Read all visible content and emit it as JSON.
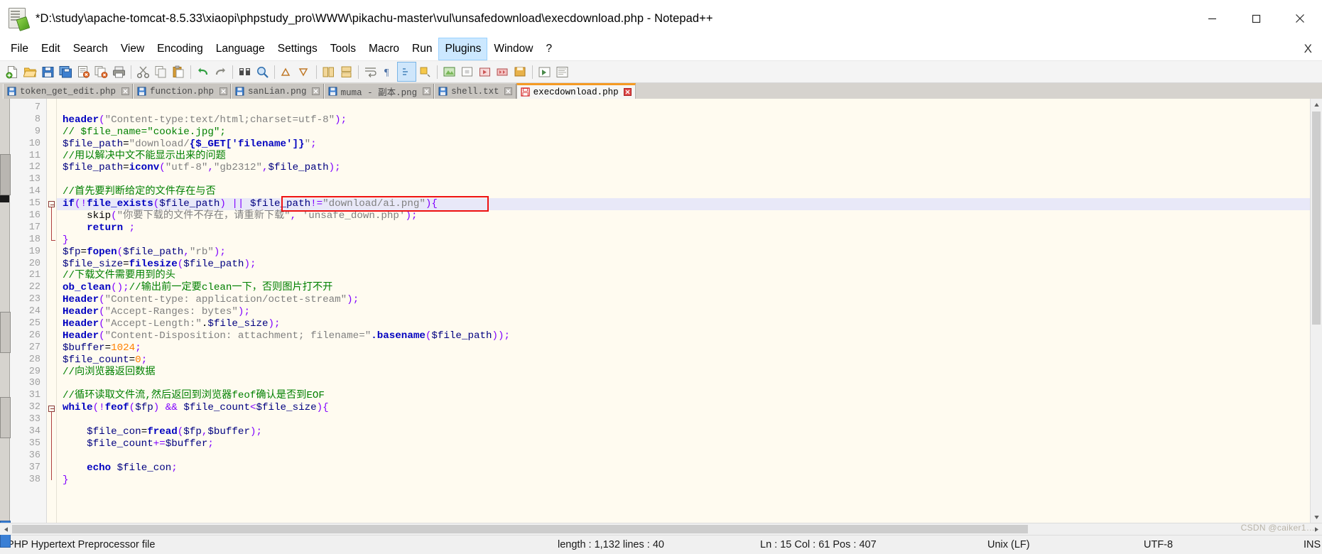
{
  "window": {
    "title": "*D:\\study\\apache-tomcat-8.5.33\\xiaopi\\phpstudy_pro\\WWW\\pikachu-master\\vul\\unsafedownload\\execdownload.php - Notepad++",
    "icon": "notepadpp-icon",
    "controls": {
      "minimize": "minimize-icon",
      "maximize": "maximize-icon",
      "close": "close-icon"
    }
  },
  "menubar": {
    "items": [
      {
        "label": "File",
        "active": false
      },
      {
        "label": "Edit",
        "active": false
      },
      {
        "label": "Search",
        "active": false
      },
      {
        "label": "View",
        "active": false
      },
      {
        "label": "Encoding",
        "active": false
      },
      {
        "label": "Language",
        "active": false
      },
      {
        "label": "Settings",
        "active": false
      },
      {
        "label": "Tools",
        "active": false
      },
      {
        "label": "Macro",
        "active": false
      },
      {
        "label": "Run",
        "active": false
      },
      {
        "label": "Plugins",
        "active": true
      },
      {
        "label": "Window",
        "active": false
      },
      {
        "label": "?",
        "active": false
      }
    ],
    "close_doc": "X"
  },
  "toolbar": {
    "buttons": [
      "new-file-icon",
      "open-file-icon",
      "save-icon",
      "save-all-icon",
      "close-file-icon",
      "close-all-icon",
      "print-icon",
      "cut-icon",
      "copy-icon",
      "paste-icon",
      "undo-icon",
      "redo-icon",
      "find-icon",
      "replace-icon",
      "zoom-in-icon",
      "zoom-out-icon",
      "sync-vertical-scroll-icon",
      "sync-horizontal-scroll-icon",
      "word-wrap-icon",
      "show-all-chars-icon",
      "indent-guide-icon",
      "uppercase-icon",
      "record-macro-icon",
      "stop-macro-icon",
      "playback-macro-icon",
      "run-macro-multiple-icon",
      "save-macro-icon",
      "run-icon",
      "document-map-icon"
    ]
  },
  "tabs": [
    {
      "label": "token_get_edit.php",
      "icon": "save-blue-icon",
      "active": false,
      "close": "close-tab-icon"
    },
    {
      "label": "function.php",
      "icon": "save-blue-icon",
      "active": false,
      "close": "close-tab-icon"
    },
    {
      "label": "sanLian.png",
      "icon": "save-blue-icon",
      "active": false,
      "close": "close-tab-icon"
    },
    {
      "label": "muma - 副本.png",
      "icon": "save-blue-icon",
      "active": false,
      "close": "close-tab-icon"
    },
    {
      "label": "shell.txt",
      "icon": "save-blue-icon",
      "active": false,
      "close": "close-tab-icon"
    },
    {
      "label": "execdownload.php",
      "icon": "save-red-icon",
      "active": true,
      "close": "close-tab-icon"
    }
  ],
  "editor": {
    "first_line": 7,
    "highlighted_line": 15,
    "lines": [
      {
        "n": 7,
        "tokens": []
      },
      {
        "n": 8,
        "tokens": [
          {
            "t": "header",
            "c": "fn"
          },
          {
            "t": "(",
            "c": "punc"
          },
          {
            "t": "\"Content-type:text/html;charset=utf-8\"",
            "c": "str"
          },
          {
            "t": ")",
            "c": "punc"
          },
          {
            "t": ";",
            "c": "punc"
          }
        ]
      },
      {
        "n": 9,
        "tokens": [
          {
            "t": "// $file_name=\"cookie.jpg\";",
            "c": "cmt"
          }
        ]
      },
      {
        "n": 10,
        "tokens": [
          {
            "t": "$file_path",
            "c": "var"
          },
          {
            "t": "=",
            "c": "plain"
          },
          {
            "t": "\"",
            "c": "str"
          },
          {
            "t": "download/",
            "c": "str"
          },
          {
            "t": "{$_GET['filename']}",
            "c": "fn"
          },
          {
            "t": "\"",
            "c": "str"
          },
          {
            "t": ";",
            "c": "punc"
          }
        ]
      },
      {
        "n": 11,
        "tokens": [
          {
            "t": "//用以解决中文不能显示出来的问题",
            "c": "cmt"
          }
        ]
      },
      {
        "n": 12,
        "tokens": [
          {
            "t": "$file_path",
            "c": "var"
          },
          {
            "t": "=",
            "c": "plain"
          },
          {
            "t": "iconv",
            "c": "fn"
          },
          {
            "t": "(",
            "c": "punc"
          },
          {
            "t": "\"utf-8\"",
            "c": "str"
          },
          {
            "t": ",",
            "c": "punc"
          },
          {
            "t": "\"gb2312\"",
            "c": "str"
          },
          {
            "t": ",",
            "c": "punc"
          },
          {
            "t": "$file_path",
            "c": "var"
          },
          {
            "t": ")",
            "c": "punc"
          },
          {
            "t": ";",
            "c": "punc"
          }
        ]
      },
      {
        "n": 13,
        "tokens": []
      },
      {
        "n": 14,
        "tokens": [
          {
            "t": "//首先要判断给定的文件存在与否",
            "c": "cmt"
          }
        ]
      },
      {
        "n": 15,
        "tokens": [
          {
            "t": "if",
            "c": "kw"
          },
          {
            "t": "(",
            "c": "punc"
          },
          {
            "t": "!",
            "c": "op"
          },
          {
            "t": "file_exists",
            "c": "fn"
          },
          {
            "t": "(",
            "c": "punc"
          },
          {
            "t": "$file_path",
            "c": "var"
          },
          {
            "t": ")",
            "c": "punc"
          },
          {
            "t": " ",
            "c": "plain"
          },
          {
            "t": "||",
            "c": "op"
          },
          {
            "t": " ",
            "c": "plain"
          },
          {
            "t": "$file_path",
            "c": "var"
          },
          {
            "t": "!=",
            "c": "op"
          },
          {
            "t": "\"download/ai.png\"",
            "c": "str"
          },
          {
            "t": ")",
            "c": "punc"
          },
          {
            "t": "{",
            "c": "brace"
          }
        ]
      },
      {
        "n": 16,
        "tokens": [
          {
            "t": "    ",
            "c": "plain"
          },
          {
            "t": "skip",
            "c": "plain"
          },
          {
            "t": "(",
            "c": "punc"
          },
          {
            "t": "\"你要下载的文件不存在，请重新下载\"",
            "c": "str"
          },
          {
            "t": ",",
            "c": "punc"
          },
          {
            "t": " ",
            "c": "plain"
          },
          {
            "t": "'unsafe_down.php'",
            "c": "str"
          },
          {
            "t": ")",
            "c": "punc"
          },
          {
            "t": ";",
            "c": "punc"
          }
        ]
      },
      {
        "n": 17,
        "tokens": [
          {
            "t": "    ",
            "c": "plain"
          },
          {
            "t": "return",
            "c": "kw"
          },
          {
            "t": " ;",
            "c": "punc"
          }
        ]
      },
      {
        "n": 18,
        "tokens": [
          {
            "t": "}",
            "c": "brace"
          }
        ]
      },
      {
        "n": 19,
        "tokens": [
          {
            "t": "$fp",
            "c": "var"
          },
          {
            "t": "=",
            "c": "plain"
          },
          {
            "t": "fopen",
            "c": "fn"
          },
          {
            "t": "(",
            "c": "punc"
          },
          {
            "t": "$file_path",
            "c": "var"
          },
          {
            "t": ",",
            "c": "punc"
          },
          {
            "t": "\"rb\"",
            "c": "str"
          },
          {
            "t": ")",
            "c": "punc"
          },
          {
            "t": ";",
            "c": "punc"
          }
        ]
      },
      {
        "n": 20,
        "tokens": [
          {
            "t": "$file_size",
            "c": "var"
          },
          {
            "t": "=",
            "c": "plain"
          },
          {
            "t": "filesize",
            "c": "fn"
          },
          {
            "t": "(",
            "c": "punc"
          },
          {
            "t": "$file_path",
            "c": "var"
          },
          {
            "t": ")",
            "c": "punc"
          },
          {
            "t": ";",
            "c": "punc"
          }
        ]
      },
      {
        "n": 21,
        "tokens": [
          {
            "t": "//下载文件需要用到的头",
            "c": "cmt"
          }
        ]
      },
      {
        "n": 22,
        "tokens": [
          {
            "t": "ob_clean",
            "c": "fn"
          },
          {
            "t": "()",
            "c": "punc"
          },
          {
            "t": ";",
            "c": "punc"
          },
          {
            "t": "//输出前一定要clean一下，否则图片打不开",
            "c": "cmt"
          }
        ]
      },
      {
        "n": 23,
        "tokens": [
          {
            "t": "Header",
            "c": "fn"
          },
          {
            "t": "(",
            "c": "punc"
          },
          {
            "t": "\"Content-type: application/octet-stream\"",
            "c": "str"
          },
          {
            "t": ")",
            "c": "punc"
          },
          {
            "t": ";",
            "c": "punc"
          }
        ]
      },
      {
        "n": 24,
        "tokens": [
          {
            "t": "Header",
            "c": "fn"
          },
          {
            "t": "(",
            "c": "punc"
          },
          {
            "t": "\"Accept-Ranges: bytes\"",
            "c": "str"
          },
          {
            "t": ")",
            "c": "punc"
          },
          {
            "t": ";",
            "c": "punc"
          }
        ]
      },
      {
        "n": 25,
        "tokens": [
          {
            "t": "Header",
            "c": "fn"
          },
          {
            "t": "(",
            "c": "punc"
          },
          {
            "t": "\"Accept-Length:\"",
            "c": "str"
          },
          {
            "t": ".",
            "c": "plain"
          },
          {
            "t": "$file_size",
            "c": "var"
          },
          {
            "t": ")",
            "c": "punc"
          },
          {
            "t": ";",
            "c": "punc"
          }
        ]
      },
      {
        "n": 26,
        "tokens": [
          {
            "t": "Header",
            "c": "fn"
          },
          {
            "t": "(",
            "c": "punc"
          },
          {
            "t": "\"Content-Disposition: attachment; filename=\"",
            "c": "str"
          },
          {
            "t": ".basename",
            "c": "fn"
          },
          {
            "t": "(",
            "c": "punc"
          },
          {
            "t": "$file_path",
            "c": "var"
          },
          {
            "t": "))",
            "c": "punc"
          },
          {
            "t": ";",
            "c": "punc"
          }
        ]
      },
      {
        "n": 27,
        "tokens": [
          {
            "t": "$buffer",
            "c": "var"
          },
          {
            "t": "=",
            "c": "plain"
          },
          {
            "t": "1024",
            "c": "num"
          },
          {
            "t": ";",
            "c": "punc"
          }
        ]
      },
      {
        "n": 28,
        "tokens": [
          {
            "t": "$file_count",
            "c": "var"
          },
          {
            "t": "=",
            "c": "plain"
          },
          {
            "t": "0",
            "c": "num"
          },
          {
            "t": ";",
            "c": "punc"
          }
        ]
      },
      {
        "n": 29,
        "tokens": [
          {
            "t": "//向浏览器返回数据",
            "c": "cmt"
          }
        ]
      },
      {
        "n": 30,
        "tokens": []
      },
      {
        "n": 31,
        "tokens": [
          {
            "t": "//循环读取文件流,然后返回到浏览器feof确认是否到EOF",
            "c": "cmt"
          }
        ]
      },
      {
        "n": 32,
        "tokens": [
          {
            "t": "while",
            "c": "kw"
          },
          {
            "t": "(",
            "c": "punc"
          },
          {
            "t": "!",
            "c": "op"
          },
          {
            "t": "feof",
            "c": "fn"
          },
          {
            "t": "(",
            "c": "punc"
          },
          {
            "t": "$fp",
            "c": "var"
          },
          {
            "t": ")",
            "c": "punc"
          },
          {
            "t": " ",
            "c": "plain"
          },
          {
            "t": "&&",
            "c": "op"
          },
          {
            "t": " ",
            "c": "plain"
          },
          {
            "t": "$file_count",
            "c": "var"
          },
          {
            "t": "<",
            "c": "op"
          },
          {
            "t": "$file_size",
            "c": "var"
          },
          {
            "t": ")",
            "c": "punc"
          },
          {
            "t": "{",
            "c": "brace"
          }
        ]
      },
      {
        "n": 33,
        "tokens": []
      },
      {
        "n": 34,
        "tokens": [
          {
            "t": "    ",
            "c": "plain"
          },
          {
            "t": "$file_con",
            "c": "var"
          },
          {
            "t": "=",
            "c": "plain"
          },
          {
            "t": "fread",
            "c": "fn"
          },
          {
            "t": "(",
            "c": "punc"
          },
          {
            "t": "$fp",
            "c": "var"
          },
          {
            "t": ",",
            "c": "punc"
          },
          {
            "t": "$buffer",
            "c": "var"
          },
          {
            "t": ")",
            "c": "punc"
          },
          {
            "t": ";",
            "c": "punc"
          }
        ]
      },
      {
        "n": 35,
        "tokens": [
          {
            "t": "    ",
            "c": "plain"
          },
          {
            "t": "$file_count",
            "c": "var"
          },
          {
            "t": "+=",
            "c": "op"
          },
          {
            "t": "$buffer",
            "c": "var"
          },
          {
            "t": ";",
            "c": "punc"
          }
        ]
      },
      {
        "n": 36,
        "tokens": []
      },
      {
        "n": 37,
        "tokens": [
          {
            "t": "    ",
            "c": "plain"
          },
          {
            "t": "echo",
            "c": "kw"
          },
          {
            "t": " ",
            "c": "plain"
          },
          {
            "t": "$file_con",
            "c": "var"
          },
          {
            "t": ";",
            "c": "punc"
          }
        ]
      },
      {
        "n": 38,
        "tokens": [
          {
            "t": "}",
            "c": "brace"
          }
        ]
      }
    ],
    "annotation": {
      "type": "red-rectangle",
      "color": "#ee1111",
      "around": "$file_path!=\"download/ai.png\""
    }
  },
  "statusbar": {
    "doc_type": "PHP Hypertext Preprocessor file",
    "length_lines": "length : 1,132   lines : 40",
    "caret": "Ln : 15   Col : 61   Pos : 407",
    "eol": "Unix (LF)",
    "encoding": "UTF-8",
    "insert_mode": "INS"
  },
  "watermark": {
    "text": "CSDN @caiker1…"
  }
}
